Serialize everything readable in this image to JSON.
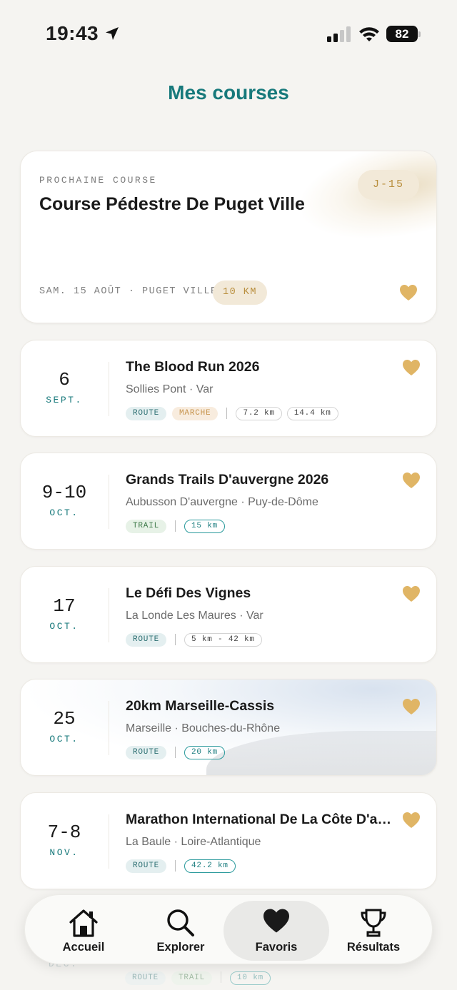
{
  "status_bar": {
    "time": "19:43",
    "battery": "82"
  },
  "header": {
    "title": "Mes courses"
  },
  "next_race": {
    "eyebrow": "PROCHAINE COURSE",
    "name": "Course Pédestre De Puget Ville",
    "countdown": "J-15",
    "meta": "SAM. 15 AOÛT · PUGET VILLE",
    "distance": "10 KM"
  },
  "races": [
    {
      "day": "6",
      "month": "SEPT.",
      "title": "The Blood Run 2026",
      "location": "Sollies Pont · Var",
      "tags": [
        "ROUTE",
        "MARCHE"
      ],
      "distances": [
        "7.2 km",
        "14.4 km"
      ]
    },
    {
      "day": "9-10",
      "month": "OCT.",
      "title": "Grands Trails D'auvergne 2026",
      "location": "Aubusson D'auvergne · Puy-de-Dôme",
      "tags": [
        "TRAIL"
      ],
      "distances": [
        "15 km"
      ]
    },
    {
      "day": "17",
      "month": "OCT.",
      "title": "Le Défi Des Vignes",
      "location": "La Londe Les Maures · Var",
      "tags": [
        "ROUTE"
      ],
      "distances": [
        "5 km - 42 km"
      ]
    },
    {
      "day": "25",
      "month": "OCT.",
      "title": "20km Marseille-Cassis",
      "location": "Marseille · Bouches-du-Rhône",
      "tags": [
        "ROUTE"
      ],
      "distances": [
        "20 km"
      ]
    },
    {
      "day": "7-8",
      "month": "NOV.",
      "title": "Marathon International De La Côte D'am...",
      "location": "La Baule · Loire-Atlantique",
      "tags": [
        "ROUTE"
      ],
      "distances": [
        "42.2 km"
      ]
    }
  ],
  "partial_card": {
    "month": "DÉC.",
    "tags": [
      "ROUTE",
      "TRAIL"
    ],
    "distance": "10 km"
  },
  "tabbar": {
    "home": "Accueil",
    "explore": "Explorer",
    "favorites": "Favoris",
    "results": "Résultats"
  },
  "colors": {
    "accent": "#17797b",
    "gold": "#e0b565",
    "background": "#f5f4f1"
  }
}
